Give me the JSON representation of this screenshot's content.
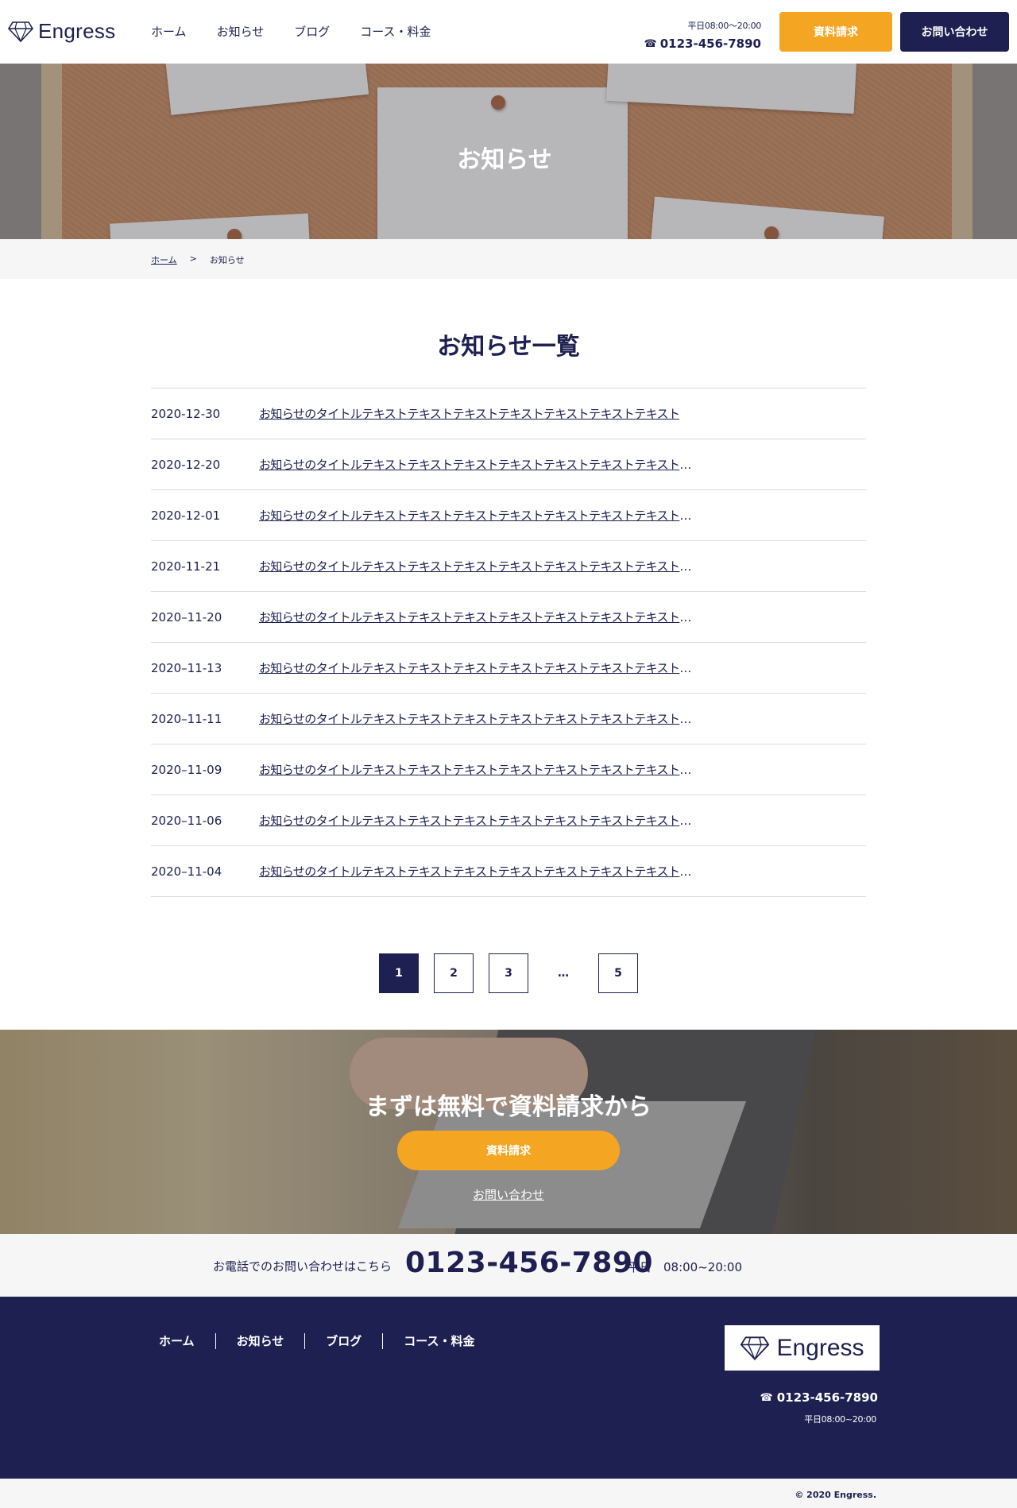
{
  "header": {
    "logo_text": "Engress",
    "nav": [
      "ホーム",
      "お知らせ",
      "ブログ",
      "コース・料金"
    ],
    "hours": "平日08:00〜20:00",
    "tel": "0123-456-7890",
    "btn_doc": "資料請求",
    "btn_contact": "お問い合わせ"
  },
  "hero": {
    "title": "お知らせ"
  },
  "breadcrumb": {
    "home": "ホーム",
    "separator": ">",
    "current": "お知らせ"
  },
  "news": {
    "title": "お知らせ一覧",
    "items": [
      {
        "date": "2020-12-30",
        "title": "お知らせのタイトルテキストテキストテキストテキストテキストテキストテキスト"
      },
      {
        "date": "2020-12-20",
        "title": "お知らせのタイトルテキストテキストテキストテキストテキストテキストテキストテキストテキスト..."
      },
      {
        "date": "2020-12-01",
        "title": "お知らせのタイトルテキストテキストテキストテキストテキストテキストテキストテキストテキスト..."
      },
      {
        "date": "2020-11-21",
        "title": "お知らせのタイトルテキストテキストテキストテキストテキストテキストテキストテキストテキスト..."
      },
      {
        "date": "2020–11-20",
        "title": "お知らせのタイトルテキストテキストテキストテキストテキストテキストテキストテキストテキスト..."
      },
      {
        "date": "2020–11-13",
        "title": "お知らせのタイトルテキストテキストテキストテキストテキストテキストテキストテキストテキスト..."
      },
      {
        "date": "2020–11-11",
        "title": "お知らせのタイトルテキストテキストテキストテキストテキストテキストテキストテキストテキスト..."
      },
      {
        "date": "2020–11-09",
        "title": "お知らせのタイトルテキストテキストテキストテキストテキストテキストテキストテキストテキスト..."
      },
      {
        "date": "2020–11-06",
        "title": "お知らせのタイトルテキストテキストテキストテキストテキストテキストテキストテキストテキスト..."
      },
      {
        "date": "2020–11-04",
        "title": "お知らせのタイトルテキストテキストテキストテキストテキストテキストテキストテキストテキスト..."
      }
    ]
  },
  "pagination": {
    "pages": [
      "1",
      "2",
      "3",
      "…",
      "5"
    ],
    "current": "1"
  },
  "cta": {
    "title": "まずは無料で資料請求から",
    "button": "資料請求",
    "link": "お問い合わせ"
  },
  "telbar": {
    "lead": "お電話でのお問い合わせはこちら",
    "number": "0123-456-7890",
    "hours": "平日　08:00~20:00"
  },
  "footer": {
    "nav": [
      "ホーム",
      "お知らせ",
      "ブログ",
      "コース・料金"
    ],
    "logo_text": "Engress",
    "tel": "0123-456-7890",
    "hours": "平日08:00~20:00",
    "copyright": "© 2020 Engress."
  },
  "colors": {
    "navy": "#1d2050",
    "orange": "#f4a522",
    "light_gray": "#f6f6f7"
  },
  "icons": {
    "logo": "diamond-icon",
    "phone": "phone-icon"
  }
}
